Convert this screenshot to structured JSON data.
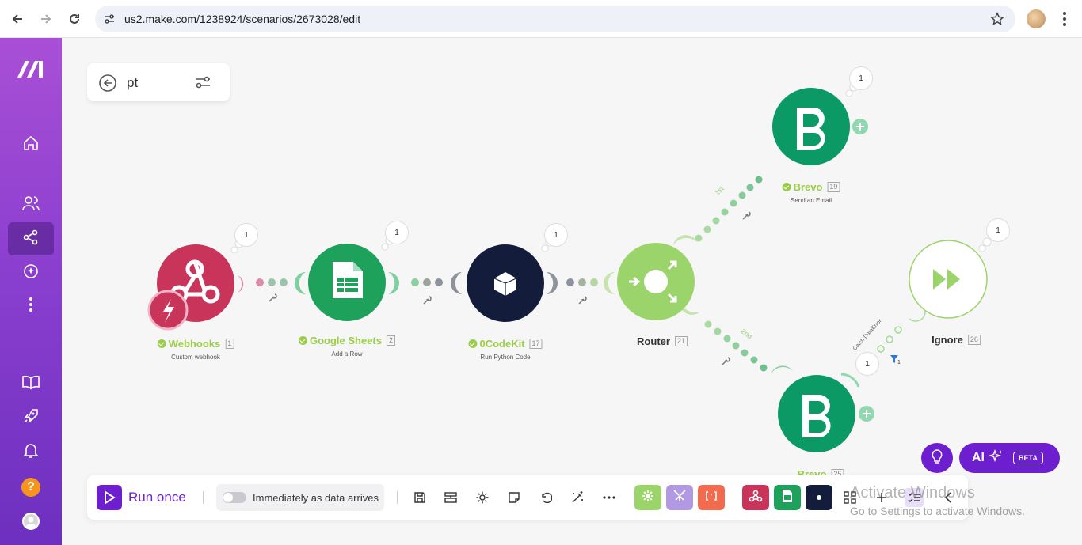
{
  "browser": {
    "url": "us2.make.com/1238924/scenarios/2673028/edit"
  },
  "scenario": {
    "name": "pt"
  },
  "modules": [
    {
      "name": "Webhooks",
      "id": "1",
      "sub": "Custom webhook",
      "ops": "1",
      "color": "#c9345b"
    },
    {
      "name": "Google Sheets",
      "id": "2",
      "sub": "Add a Row",
      "ops": "1",
      "color": "#1da15b"
    },
    {
      "name": "0CodeKit",
      "id": "17",
      "sub": "Run Python Code",
      "ops": "1",
      "color": "#131d3b"
    },
    {
      "name": "Router",
      "id": "21",
      "color": "#9bd46a"
    },
    {
      "name": "Brevo",
      "id": "19",
      "sub": "Send an Email",
      "ops": "1",
      "color": "#0b9966"
    },
    {
      "name": "Brevo",
      "id": "25",
      "ops": "1",
      "color": "#0b9966"
    },
    {
      "name": "Ignore",
      "id": "26",
      "ops": "1",
      "color": "#9bd46a"
    }
  ],
  "routes": {
    "first": "1st",
    "second": "2nd",
    "error": "Catch DataError",
    "error_badge": "1"
  },
  "toolbar": {
    "run_label": "Run once",
    "schedule_label": "Immediately as data arrives"
  },
  "ai": {
    "label": "AI",
    "badge": "BETA"
  },
  "watermark": {
    "line1": "Activate Windows",
    "line2": "Go to Settings to activate Windows."
  },
  "colors": {
    "brand": "#6d1fd0",
    "sidebar_top": "#a94fd6",
    "success": "#9acd4a"
  }
}
